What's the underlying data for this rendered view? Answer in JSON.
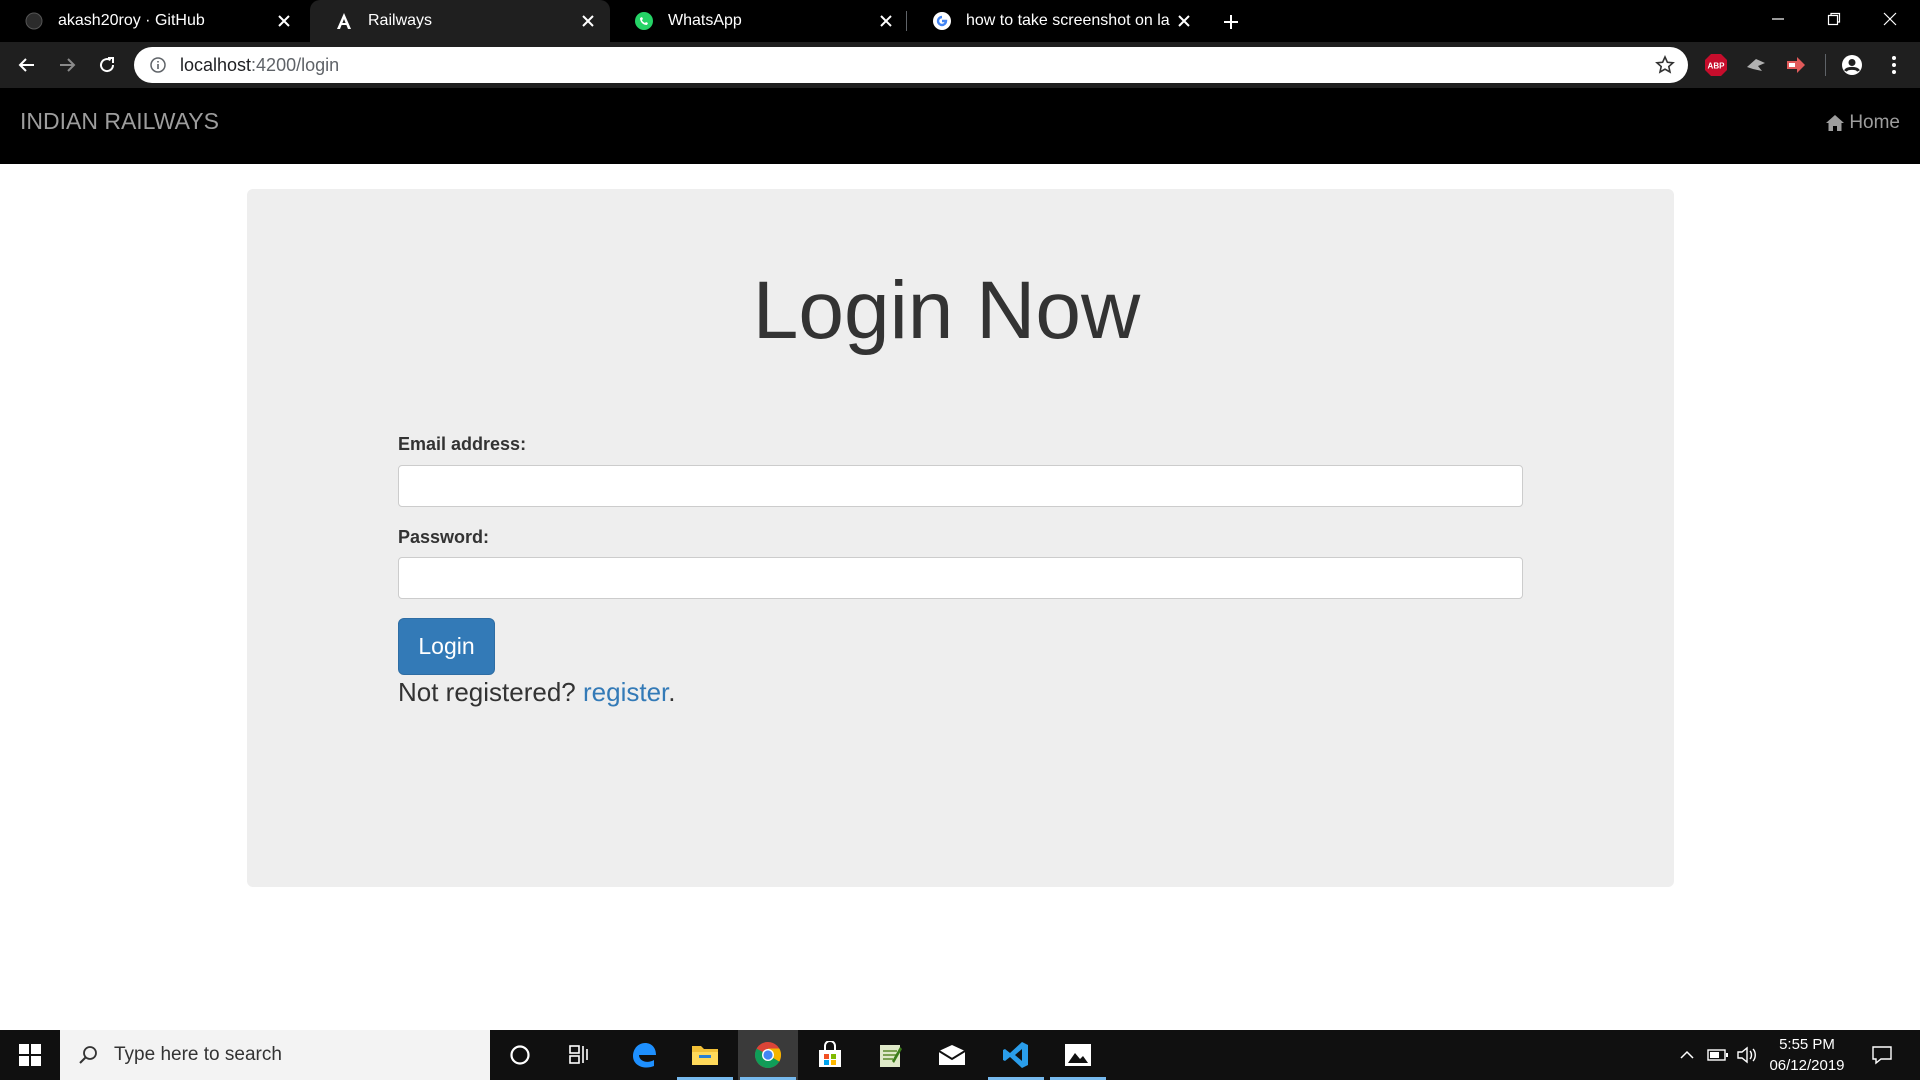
{
  "browser": {
    "tabs": [
      {
        "title": "akash20roy · GitHub",
        "icon": "github-icon"
      },
      {
        "title": "Railways",
        "icon": "angular-icon"
      },
      {
        "title": "WhatsApp",
        "icon": "whatsapp-icon"
      },
      {
        "title": "how to take screenshot on laptop",
        "icon": "google-icon"
      }
    ],
    "active_tab": 1,
    "url": {
      "host": "localhost",
      "path": ":4200/login"
    },
    "extensions": [
      "abp-icon",
      "extension-icon",
      "extension-icon",
      "profile-icon",
      "menu-icon"
    ]
  },
  "app": {
    "brand": "INDIAN RAILWAYS",
    "nav": {
      "home": "Home"
    }
  },
  "login": {
    "heading": "Login Now",
    "email_label": "Email address:",
    "email_value": "",
    "password_label": "Password:",
    "password_value": "",
    "button": "Login",
    "not_registered": "Not registered? ",
    "register_link": "register",
    "period": "."
  },
  "taskbar": {
    "search_placeholder": "Type here to search",
    "apps": [
      "cortana-icon",
      "task-view-icon",
      "edge-icon",
      "file-explorer-icon",
      "chrome-icon",
      "store-icon",
      "notepad-icon",
      "mail-icon",
      "vscode-icon",
      "photos-icon"
    ],
    "time": "5:55 PM",
    "date": "06/12/2019"
  },
  "colors": {
    "accent": "#337ab7",
    "navbar": "#000000",
    "jumbotron": "#eeeeee"
  }
}
